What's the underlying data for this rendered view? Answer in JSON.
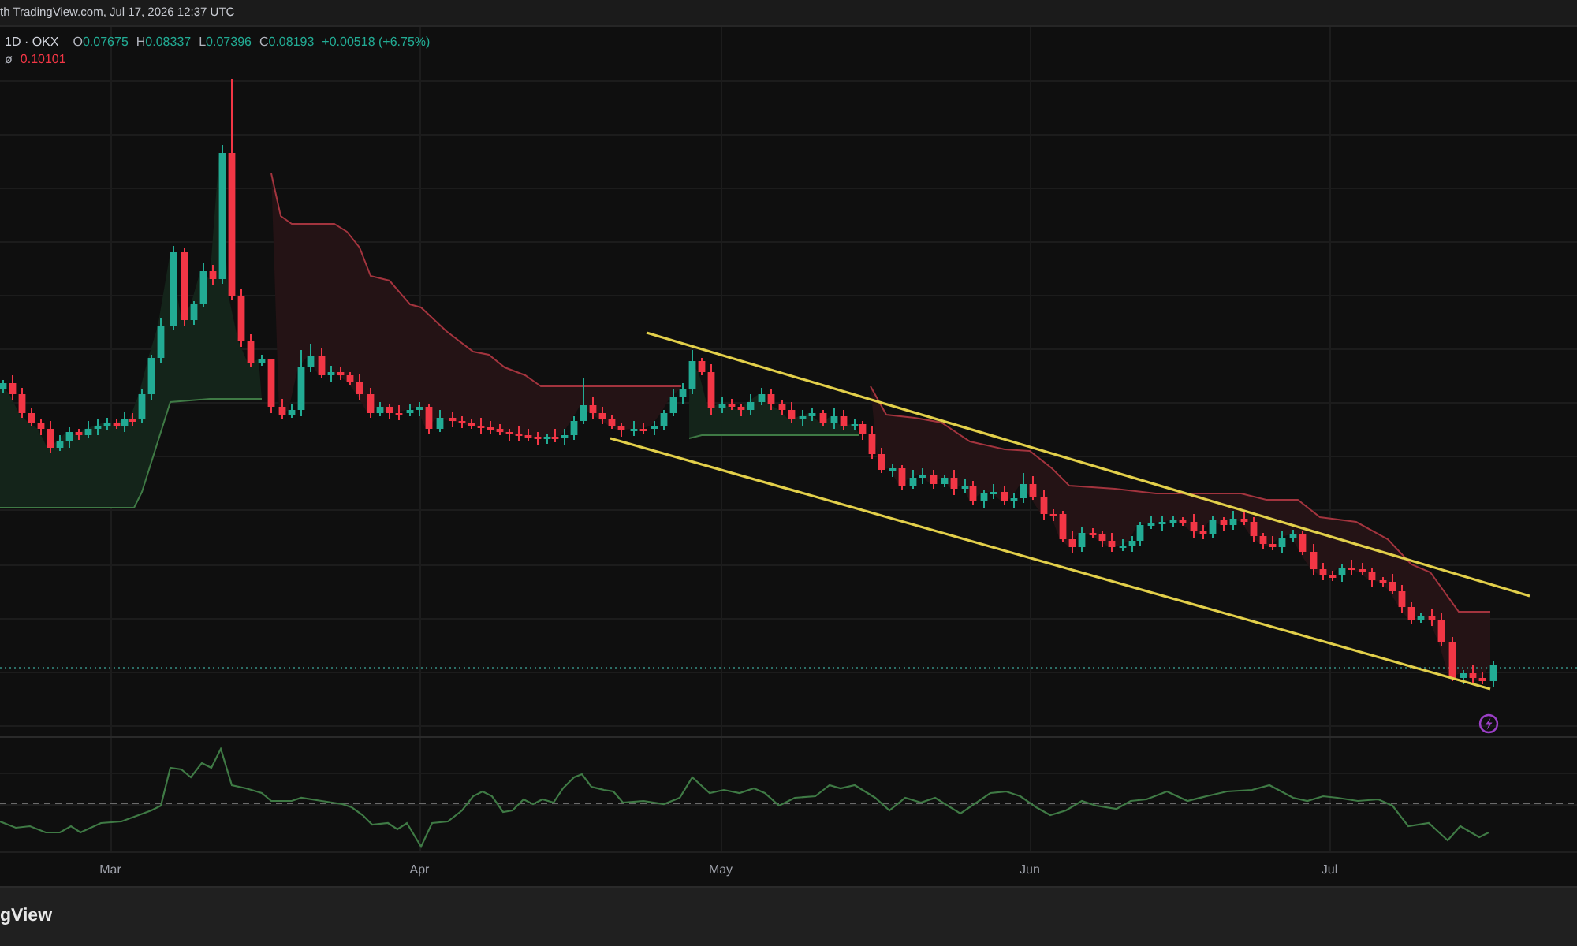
{
  "header": {
    "text": "th TradingView.com, Jul 17, 2026 12:37 UTC"
  },
  "legend": {
    "symbol": "1D · OKX",
    "rising": true,
    "ohlc": [
      {
        "label": "O",
        "value": "0.07675"
      },
      {
        "label": "H",
        "value": "0.08337"
      },
      {
        "label": "L",
        "value": "0.07396"
      },
      {
        "label": "C",
        "value": "0.08193"
      }
    ],
    "change": "+0.00518 (+6.75%)",
    "indicator": {
      "symbol": "ø",
      "value": "0.10101"
    }
  },
  "x_axis": {
    "labels": [
      "Mar",
      "Apr",
      "May",
      "Jun",
      "Jul"
    ]
  },
  "footer": {
    "logo_text": "gView"
  }
}
